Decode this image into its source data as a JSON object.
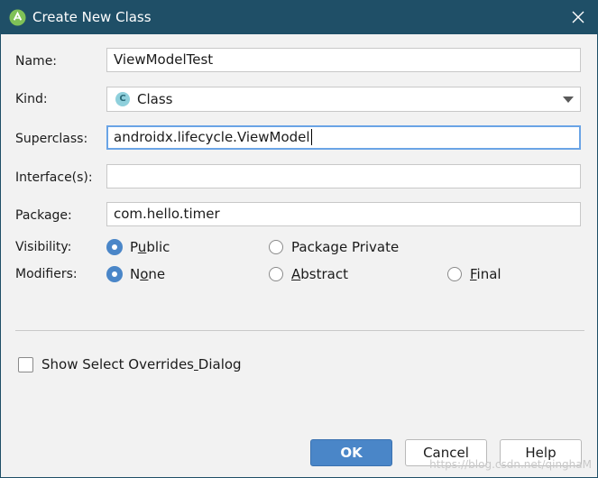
{
  "window": {
    "title": "Create New Class"
  },
  "form": {
    "name_label": "Name:",
    "name_value": "ViewModelTest",
    "kind_label": "Kind:",
    "kind_value": "Class",
    "kind_icon_letter": "C",
    "superclass_label": "Superclass:",
    "superclass_value": "androidx.lifecycle.ViewModel",
    "interfaces_label": "Interface(s):",
    "interfaces_value": "",
    "package_label": "Package:",
    "package_value": "com.hello.timer",
    "visibility_label": "Visibility:",
    "visibility_options": [
      {
        "label": "Public",
        "mnemonic_index": 1,
        "checked": true
      },
      {
        "label": "Package Private",
        "mnemonic_index": -1,
        "checked": false
      }
    ],
    "modifiers_label": "Modifiers:",
    "modifier_options": [
      {
        "label": "None",
        "mnemonic_index": 1,
        "checked": true
      },
      {
        "label": "Abstract",
        "mnemonic_index": 0,
        "checked": false
      },
      {
        "label": "Final",
        "mnemonic_index": 0,
        "checked": false
      }
    ],
    "show_overrides_label": "Show Select Overrides Dialog",
    "show_overrides_mnemonic_index": 21,
    "show_overrides_checked": false
  },
  "buttons": {
    "ok": "OK",
    "cancel": "Cancel",
    "help": "Help"
  },
  "watermark": "https://blog.csdn.net/qinghaM",
  "colors": {
    "titlebar": "#1f4f67",
    "accent": "#4a86c8",
    "focus_border": "#6aa4e6",
    "background": "#f2f2f2"
  }
}
